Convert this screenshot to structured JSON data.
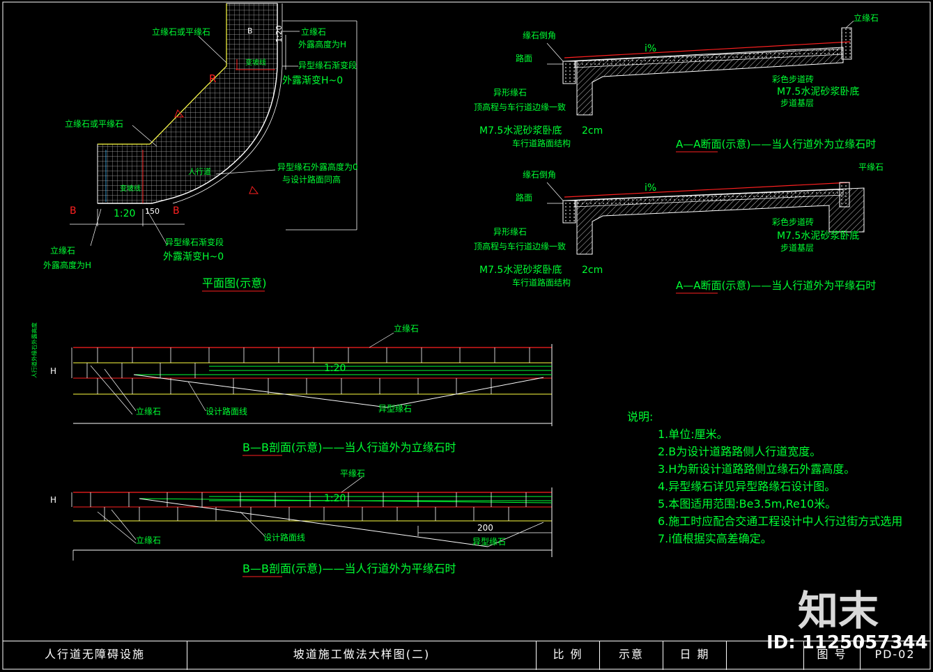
{
  "plan": {
    "title": "平面图(示意)",
    "labels": {
      "curb_or_flat_top": "立缘石或平缘石",
      "curb_top_right": "立缘石",
      "exposed_height_h": "外露高度为H",
      "special_curb_transition": "异型缘石渐变段",
      "exposed_taper": "外露渐变H~0",
      "slope_label": "变坡线",
      "r_label": "R",
      "curb_or_flat_mid": "立缘石或平缘石",
      "sidewalk": "人行道",
      "special_zero_1": "异型缘石外露高度为0",
      "special_zero_2": "与设计路面同高",
      "slope_label2": "变坡线",
      "b_left": "B",
      "b_right": "B",
      "b_top": "B",
      "ratio": "1:20",
      "dim_150": "150",
      "curb_bottom": "立缘石",
      "exposed_bottom": "外露高度为H",
      "trans_bottom": "异型缘石渐变段",
      "taper_bottom": "外露渐变H~0",
      "dim_v": "1:20"
    }
  },
  "section_aa_1": {
    "labels": {
      "curb_chamfer": "缘石倒角",
      "road": "路面",
      "special_curb": "异形缘石",
      "top_level": "顶高程与车行道边缘一致",
      "mortar": "M7.5水泥砂浆卧底",
      "mortar_thick": "2cm",
      "road_structure": "车行道路面结构",
      "slope": "i%",
      "curb_right": "立缘石",
      "color_brick": "彩色步道砖",
      "mortar_right": "M7.5水泥砂浆卧底",
      "base": "步道基层"
    },
    "caption": "A—A断面(示意)——当人行道外为立缘石时"
  },
  "section_aa_2": {
    "labels": {
      "curb_chamfer": "缘石倒角",
      "road": "路面",
      "special_curb": "异形缘石",
      "top_level": "顶高程与车行道边缘一致",
      "mortar": "M7.5水泥砂浆卧底",
      "mortar_thick": "2cm",
      "road_structure": "车行道路面结构",
      "slope": "i%",
      "curb_right": "平缘石",
      "color_brick": "彩色步道砖",
      "mortar_right": "M7.5水泥砂浆卧底",
      "base": "步道基层"
    },
    "caption": "A—A断面(示意)——当人行道外为平缘石时"
  },
  "section_bb_1": {
    "labels": {
      "curb_top": "立缘石",
      "vertical": "人行道外缘石外露高度",
      "h": "H",
      "ratio": "1:20",
      "curb": "立缘石",
      "design_line": "设计路面线",
      "special_curb": "异型缘石"
    },
    "caption": "B—B剖面(示意)——当人行道外为立缘石时"
  },
  "section_bb_2": {
    "labels": {
      "flat_top": "平缘石",
      "h": "H",
      "ratio": "1:20",
      "curb": "立缘石",
      "design_line": "设计路面线",
      "dim_200": "200",
      "special_curb": "异型缘石"
    },
    "caption": "B—B剖面(示意)——当人行道外为平缘石时"
  },
  "notes": {
    "title": "说明:",
    "items": [
      "1.单位:厘米。",
      "2.B为设计道路路侧人行道宽度。",
      "3.H为新设计道路路侧立缘石外露高度。",
      "4.异型缘石详见异型路缘石设计图。",
      "5.本图适用范围:Be3.5m,Re10米。",
      "6.施工时应配合交通工程设计中人行过街方式选用",
      "7.i值根据实高差确定。"
    ]
  },
  "titleblock": {
    "project": "人行道无障碍设施",
    "drawing": "坡道施工做法大样图(二)",
    "scale_label": "比  例",
    "scale_value": "示意",
    "date_label": "日  期",
    "sheet_label": "图  号",
    "sheet_value": "PD-02"
  },
  "watermark": {
    "brand": "知末",
    "id": "ID: 1125057344"
  },
  "colors": {
    "bg": "#000000",
    "green": "#00ff33",
    "red": "#ff2020",
    "white": "#ffffff",
    "yellow": "#ffff40",
    "cyan": "#40c0ff"
  }
}
